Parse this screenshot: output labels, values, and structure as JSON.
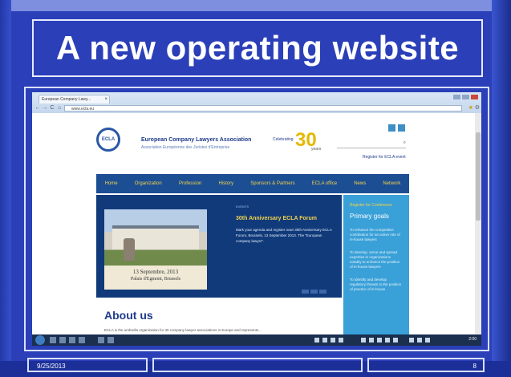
{
  "slide": {
    "title": "A new operating website",
    "footer_date": "9/25/2013",
    "page_number": "8"
  },
  "browser": {
    "tab_title": "European Company Lawy...",
    "tab_close": "×",
    "address": "www.ecla.eu",
    "back": "←",
    "forward": "→",
    "reload": "C",
    "home": "⌂"
  },
  "site": {
    "logo_text": "ECLA",
    "org_name": "European Company Lawyers Association",
    "org_sub": "Association Européenne des Juristes d'Entreprise",
    "celebrating": "Celebrating",
    "anniversary_number": "30",
    "anniversary_years": "years",
    "search_icon": "⌕",
    "register_link": "Register for ECLA event",
    "nav": [
      "Home",
      "Organization",
      "Profession",
      "History",
      "Sponsors & Partners",
      "ECLA office",
      "News",
      "Network"
    ],
    "hero": {
      "tag": "EVENTS",
      "news_title": "30th Anniversary ECLA Forum",
      "news_body": "Mark your agenda and register now! 30th Anniversary ECLA Forum, Brussels, 13 September 2013. The \"European company lawyer\".",
      "caption_line1": "13 Septembre, 2013",
      "caption_line2": "Palais d'Egmont, Brussels"
    },
    "sidebar": {
      "register": "Register for Conference",
      "heading": "Primary goals",
      "items": [
        "To enhance the competitive contribution for an active role of in-house lawyers",
        "To develop, serve and spread expertise in organizations notably to enhance the position of in-house lawyers",
        "To identify and develop regulatory threats to the position of practice of in-house"
      ]
    },
    "about_title": "About us",
    "about_text": "ECLA is the umbrella organization for 30 company lawyer associations in Europe and represents..."
  },
  "taskbar": {
    "clock": "2:00"
  }
}
